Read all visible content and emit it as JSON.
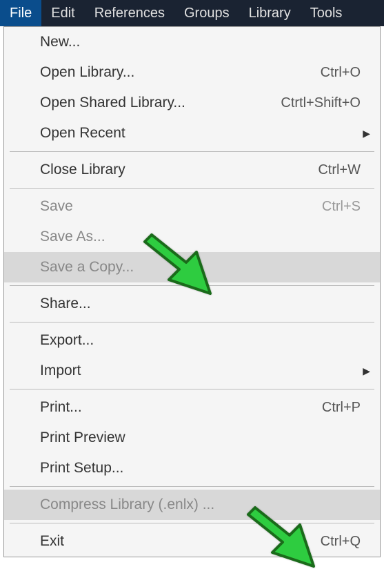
{
  "menubar": {
    "items": [
      {
        "label": "File",
        "active": true
      },
      {
        "label": "Edit",
        "active": false
      },
      {
        "label": "References",
        "active": false
      },
      {
        "label": "Groups",
        "active": false
      },
      {
        "label": "Library",
        "active": false
      },
      {
        "label": "Tools",
        "active": false
      }
    ]
  },
  "dropdown": {
    "sections": [
      [
        {
          "label": "New...",
          "shortcut": "",
          "disabled": false,
          "submenu": false,
          "highlighted": false
        },
        {
          "label": "Open Library...",
          "shortcut": "Ctrl+O",
          "disabled": false,
          "submenu": false,
          "highlighted": false
        },
        {
          "label": "Open Shared Library...",
          "shortcut": "Ctrtl+Shift+O",
          "disabled": false,
          "submenu": false,
          "highlighted": false
        },
        {
          "label": "Open Recent",
          "shortcut": "",
          "disabled": false,
          "submenu": true,
          "highlighted": false
        }
      ],
      [
        {
          "label": "Close Library",
          "shortcut": "Ctrl+W",
          "disabled": false,
          "submenu": false,
          "highlighted": false
        }
      ],
      [
        {
          "label": "Save",
          "shortcut": "Ctrl+S",
          "disabled": true,
          "submenu": false,
          "highlighted": false
        },
        {
          "label": "Save As...",
          "shortcut": "",
          "disabled": true,
          "submenu": false,
          "highlighted": false
        },
        {
          "label": "Save a Copy...",
          "shortcut": "",
          "disabled": true,
          "submenu": false,
          "highlighted": true
        }
      ],
      [
        {
          "label": "Share...",
          "shortcut": "",
          "disabled": false,
          "submenu": false,
          "highlighted": false
        }
      ],
      [
        {
          "label": "Export...",
          "shortcut": "",
          "disabled": false,
          "submenu": false,
          "highlighted": false
        },
        {
          "label": "Import",
          "shortcut": "",
          "disabled": false,
          "submenu": true,
          "highlighted": false
        }
      ],
      [
        {
          "label": "Print...",
          "shortcut": "Ctrl+P",
          "disabled": false,
          "submenu": false,
          "highlighted": false
        },
        {
          "label": "Print Preview",
          "shortcut": "",
          "disabled": false,
          "submenu": false,
          "highlighted": false
        },
        {
          "label": "Print Setup...",
          "shortcut": "",
          "disabled": false,
          "submenu": false,
          "highlighted": false
        }
      ],
      [
        {
          "label": "Compress Library (.enlx) ...",
          "shortcut": "",
          "disabled": true,
          "submenu": false,
          "highlighted": true
        }
      ],
      [
        {
          "label": "Exit",
          "shortcut": "Ctrl+Q",
          "disabled": false,
          "submenu": false,
          "highlighted": false
        }
      ]
    ]
  },
  "annotations": {
    "arrow_color": "#2ecc40"
  }
}
